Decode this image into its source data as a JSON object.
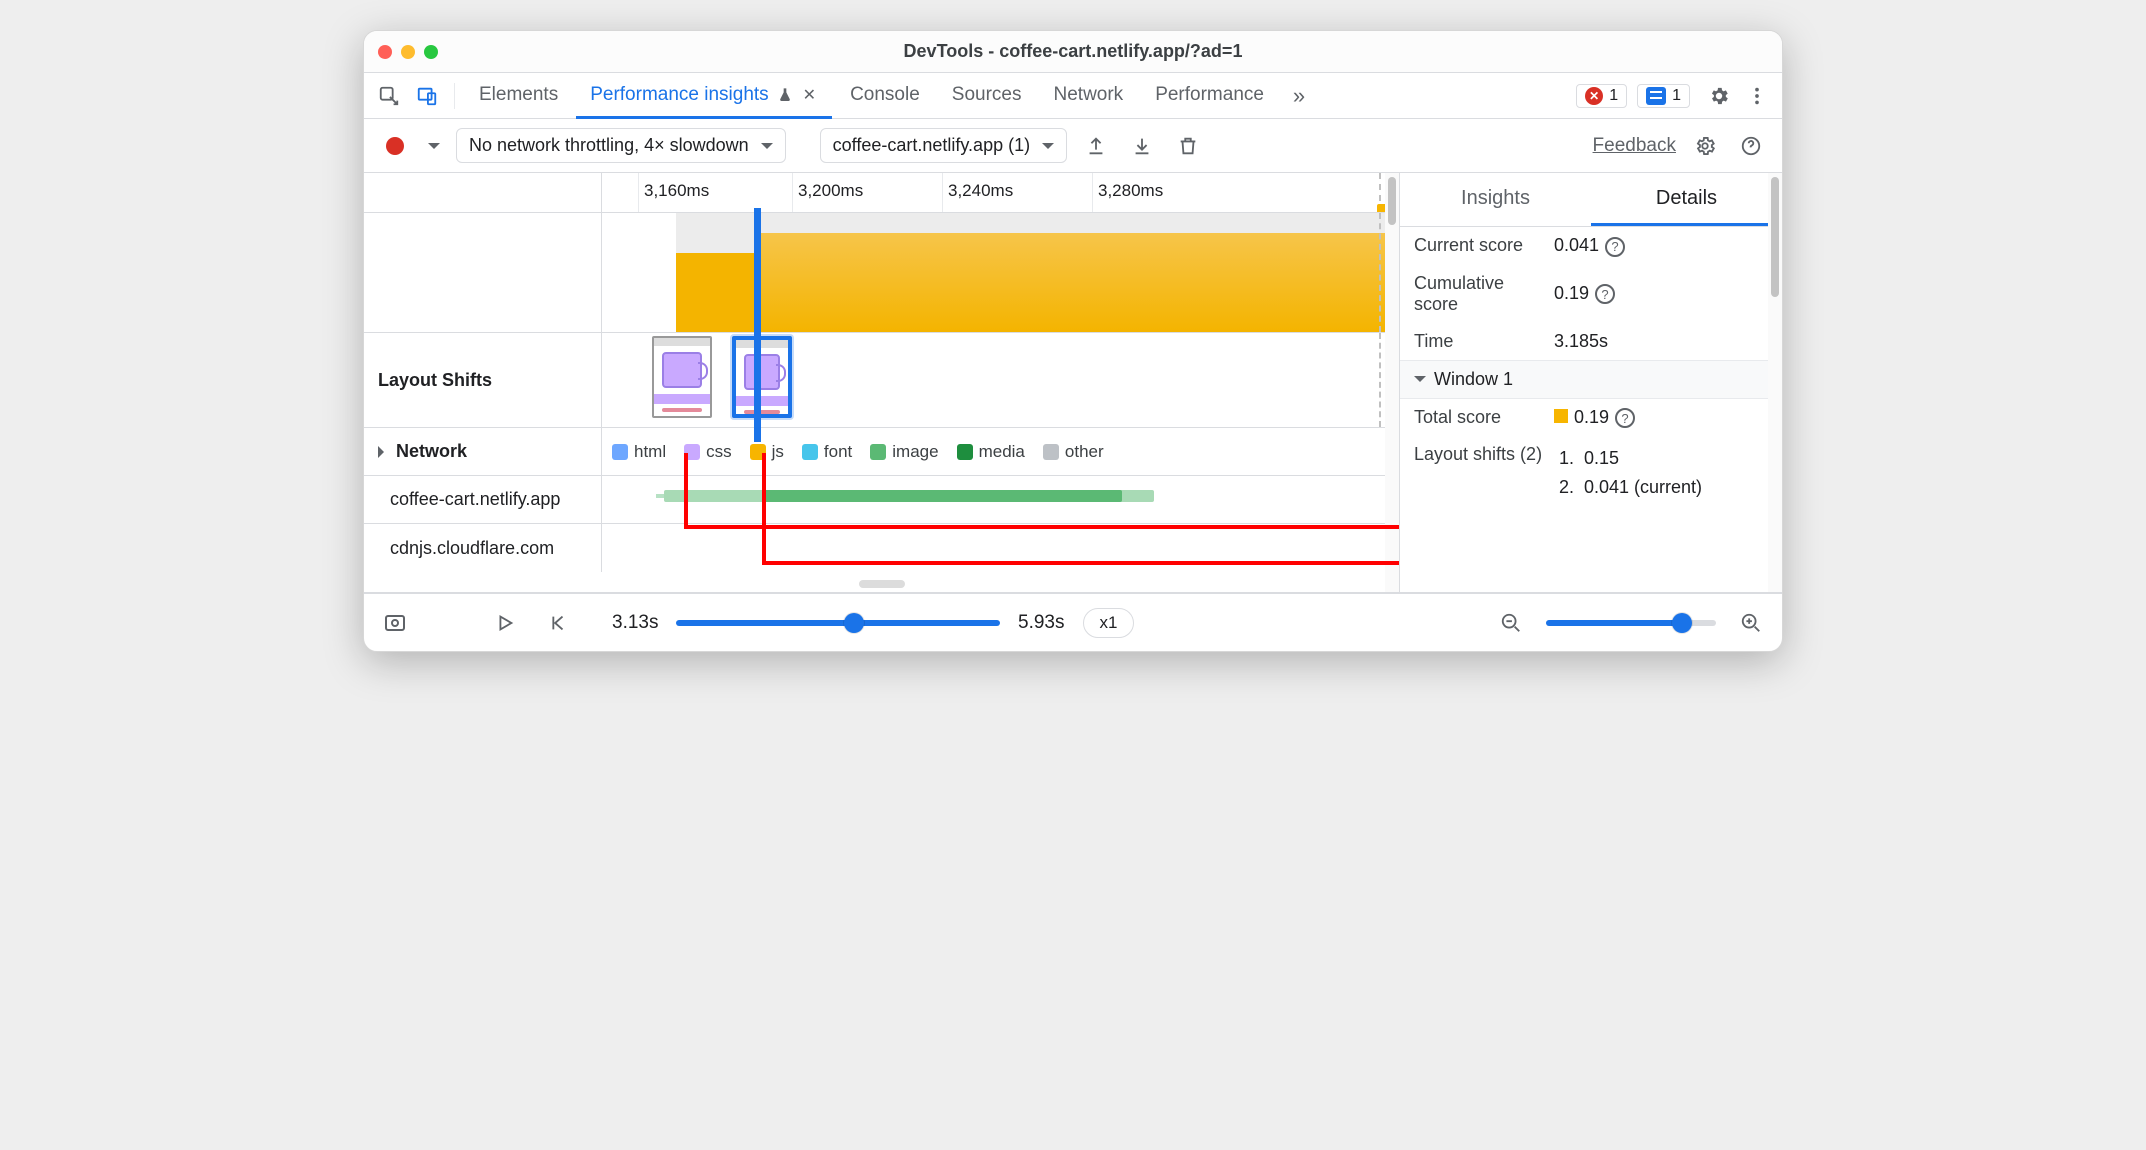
{
  "window": {
    "title": "DevTools - coffee-cart.netlify.app/?ad=1"
  },
  "topbar": {
    "tabs": [
      "Elements",
      "Performance insights",
      "Console",
      "Sources",
      "Network",
      "Performance"
    ],
    "active_index": 1,
    "experiment_flask_title": "Experiment",
    "errors_count": "1",
    "messages_count": "1"
  },
  "toolbar": {
    "throttling": "No network throttling, 4× slowdown",
    "recording": "coffee-cart.netlify.app (1)",
    "feedback": "Feedback"
  },
  "timeline": {
    "ticks": [
      "3,160ms",
      "3,200ms",
      "3,240ms",
      "3,280ms"
    ],
    "rows": {
      "layout_shifts": "Layout Shifts",
      "network": "Network",
      "host1": "coffee-cart.netlify.app",
      "host2": "cdnjs.cloudflare.com"
    },
    "legend": {
      "html": "html",
      "css": "css",
      "js": "js",
      "font": "font",
      "image": "image",
      "media": "media",
      "other": "other"
    }
  },
  "details": {
    "tabs": {
      "insights": "Insights",
      "details": "Details"
    },
    "active": "details",
    "current_score_label": "Current score",
    "current_score_value": "0.041",
    "cumulative_score_label": "Cumulative score",
    "cumulative_score_value": "0.19",
    "time_label": "Time",
    "time_value": "3.185s",
    "window_label": "Window 1",
    "total_score_label": "Total score",
    "total_score_value": "0.19",
    "shifts_label": "Layout shifts (2)",
    "shift1": {
      "n": "1.",
      "v": "0.15"
    },
    "shift2": {
      "n": "2.",
      "v": "0.041 (current)"
    }
  },
  "footer": {
    "start": "3.13s",
    "end": "5.93s",
    "speed": "x1"
  }
}
